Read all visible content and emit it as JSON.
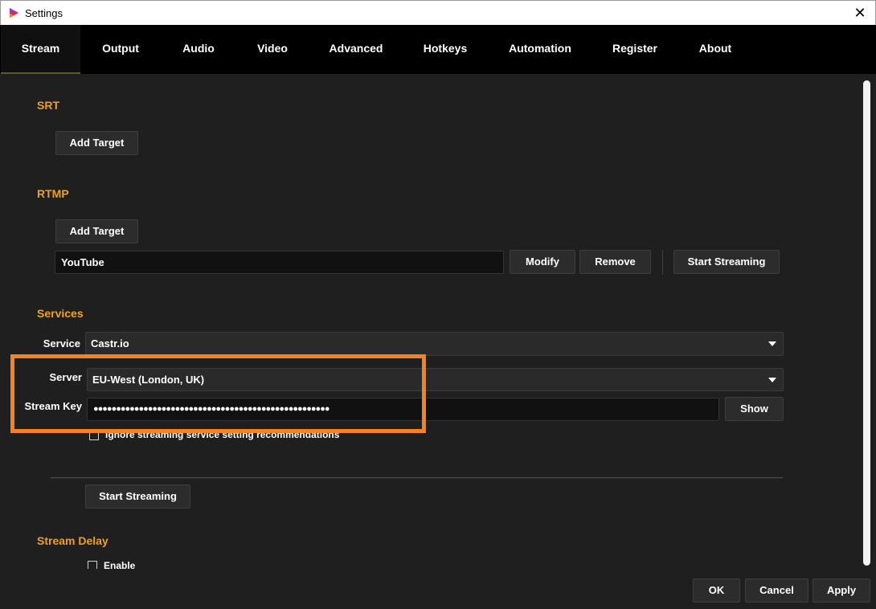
{
  "window": {
    "title": "Settings"
  },
  "tabs": [
    {
      "label": "Stream",
      "active": true
    },
    {
      "label": "Output"
    },
    {
      "label": "Audio"
    },
    {
      "label": "Video"
    },
    {
      "label": "Advanced"
    },
    {
      "label": "Hotkeys"
    },
    {
      "label": "Automation"
    },
    {
      "label": "Register"
    },
    {
      "label": "About"
    }
  ],
  "srt": {
    "title": "SRT",
    "add_target_label": "Add Target"
  },
  "rtmp": {
    "title": "RTMP",
    "add_target_label": "Add Target",
    "target_name": "YouTube",
    "modify_label": "Modify",
    "remove_label": "Remove",
    "start_streaming_label": "Start Streaming"
  },
  "services": {
    "title": "Services",
    "service_label": "Service",
    "service_value": "Castr.io",
    "server_label": "Server",
    "server_value": "EU-West (London, UK)",
    "stream_key_label": "Stream Key",
    "stream_key_value": "●●●●●●●●●●●●●●●●●●●●●●●●●●●●●●●●●●●●●●●●●●●●●●●●●●●●",
    "show_label": "Show",
    "ignore_label": "Ignore streaming service setting recommendations",
    "start_streaming_label": "Start Streaming"
  },
  "stream_delay": {
    "title": "Stream Delay",
    "enable_label": "Enable"
  },
  "footer": {
    "ok_label": "OK",
    "cancel_label": "Cancel",
    "apply_label": "Apply"
  },
  "colors": {
    "accent": "#f0a020",
    "highlight": "#f58220",
    "tab_bar": "#000000",
    "background": "#1f1f1f"
  },
  "icons": {
    "app": "app-logo-icon",
    "close": "close-icon",
    "dropdown": "chevron-down-icon"
  }
}
